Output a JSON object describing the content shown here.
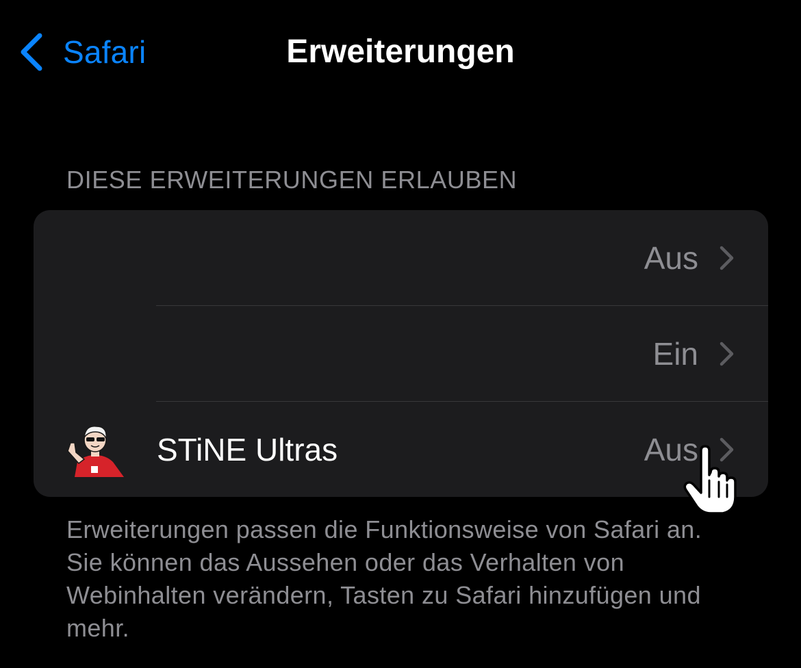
{
  "nav": {
    "back_label": "Safari",
    "back_icon": "chevron-left-icon",
    "title": "Erweiterungen"
  },
  "section": {
    "header": "DIESE ERWEITERUNGEN ERLAUBEN",
    "rows": [
      {
        "name": "",
        "value": "Aus"
      },
      {
        "name": "",
        "value": "Ein"
      },
      {
        "name": "STiNE Ultras",
        "value": "Aus",
        "icon": "stine-ultras-mascot-icon"
      }
    ],
    "footer": "Erweiterungen passen die Funktionsweise von Safari an. Sie können das Aussehen oder das Verhalten von Webinhalten verändern, Tasten zu Safari hinzufügen und mehr."
  },
  "colors": {
    "background": "#000000",
    "group_background": "#1c1c1e",
    "accent": "#0a84ff",
    "secondary_text": "#8e8e93",
    "separator": "#38383a"
  },
  "cursor": {
    "icon": "hand-pointer-icon"
  }
}
